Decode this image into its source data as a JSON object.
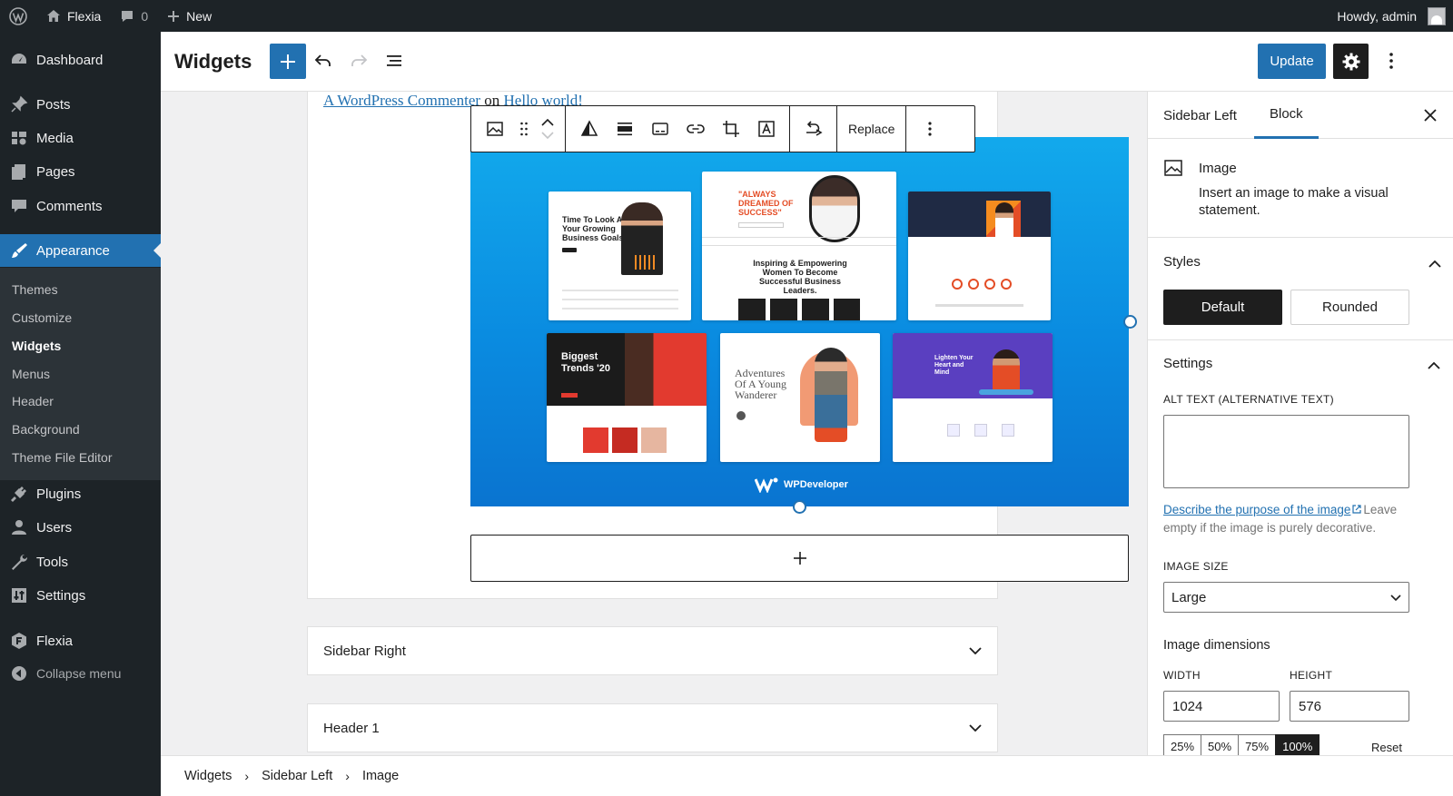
{
  "adminbar": {
    "site_name": "Flexia",
    "comment_count": "0",
    "new_label": "New",
    "howdy": "Howdy, admin"
  },
  "menu": {
    "dashboard": "Dashboard",
    "posts": "Posts",
    "media": "Media",
    "pages": "Pages",
    "comments": "Comments",
    "appearance": "Appearance",
    "submenu": [
      "Themes",
      "Customize",
      "Widgets",
      "Menus",
      "Header",
      "Background",
      "Theme File Editor"
    ],
    "plugins": "Plugins",
    "users": "Users",
    "tools": "Tools",
    "settings": "Settings",
    "flexia": "Flexia",
    "collapse": "Collapse menu"
  },
  "header": {
    "title": "Widgets",
    "update_label": "Update"
  },
  "canvas": {
    "commenter_name": "A WordPress Commenter",
    "commenter_on": "on",
    "post_link": "Hello world!",
    "toolbar_replace": "Replace",
    "image": {
      "thumb1": "Time To Look At Your Growing Business Goals",
      "thumb2": "\"ALWAYS DREAMED OF SUCCESS\"",
      "thumb2b": "Inspiring & Empowering Women To Become Successful Business Leaders.",
      "thumb4": "Biggest Trends '20",
      "thumb5": "Adventures Of A Young Wanderer",
      "thumb6": "Lighten Your Heart and Mind",
      "brand": "WPDeveloper"
    },
    "panels": [
      "Sidebar Right",
      "Header 1"
    ]
  },
  "sidebar": {
    "tabs": [
      "Sidebar Left",
      "Block"
    ],
    "active_tab": "Block",
    "block_name": "Image",
    "block_desc": "Insert an image to make a visual statement.",
    "styles_title": "Styles",
    "style_default": "Default",
    "style_rounded": "Rounded",
    "settings_title": "Settings",
    "alt_label": "ALT TEXT (ALTERNATIVE TEXT)",
    "alt_value": "",
    "help_link": "Describe the purpose of the image",
    "help_rest": "Leave empty if the image is purely decorative.",
    "image_size_label": "IMAGE SIZE",
    "image_size_value": "Large",
    "dimensions_title": "Image dimensions",
    "width_label": "WIDTH",
    "height_label": "HEIGHT",
    "width_value": "1024",
    "height_value": "576",
    "percents": [
      "25%",
      "50%",
      "75%",
      "100%"
    ],
    "reset_label": "Reset"
  },
  "breadcrumb": [
    "Widgets",
    "Sidebar Left",
    "Image"
  ],
  "colors": {
    "accent": "#2271b1",
    "adminbar": "#1d2327",
    "dark": "#1e1e1e"
  }
}
